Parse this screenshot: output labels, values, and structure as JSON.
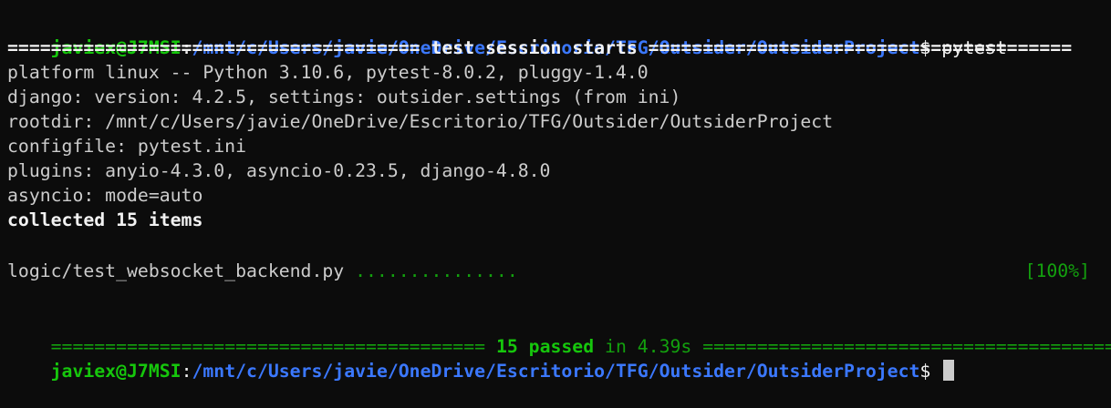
{
  "prompt": {
    "user_host": "javiex@J7MSI",
    "separator": ":",
    "path": "/mnt/c/Users/javie/OneDrive/Escritorio/TFG/Outsider/OutsiderProject",
    "symbol": "$"
  },
  "command": " pytest",
  "session_header": "====================================== test session starts =======================================",
  "info_lines": [
    "platform linux -- Python 3.10.6, pytest-8.0.2, pluggy-1.4.0",
    "django: version: 4.2.5, settings: outsider.settings (from ini)",
    "rootdir: /mnt/c/Users/javie/OneDrive/Escritorio/TFG/Outsider/OutsiderProject",
    "configfile: pytest.ini",
    "plugins: anyio-4.3.0, asyncio-0.23.5, django-4.8.0",
    "asyncio: mode=auto"
  ],
  "collected": "collected 15 items",
  "test_file": {
    "name": "logic/test_websocket_backend.py ",
    "dots": "...............",
    "progress": "[100%]"
  },
  "summary": {
    "left_rule": "======================================== ",
    "passed": "15 passed",
    "time": " in 4.39s ",
    "right_rule": "========================================="
  },
  "colors": {
    "background": "#0c0c0c",
    "foreground": "#cccccc",
    "prompt_user": "#16c60c",
    "prompt_path": "#3b78ff",
    "pass_green": "#13a10e"
  }
}
